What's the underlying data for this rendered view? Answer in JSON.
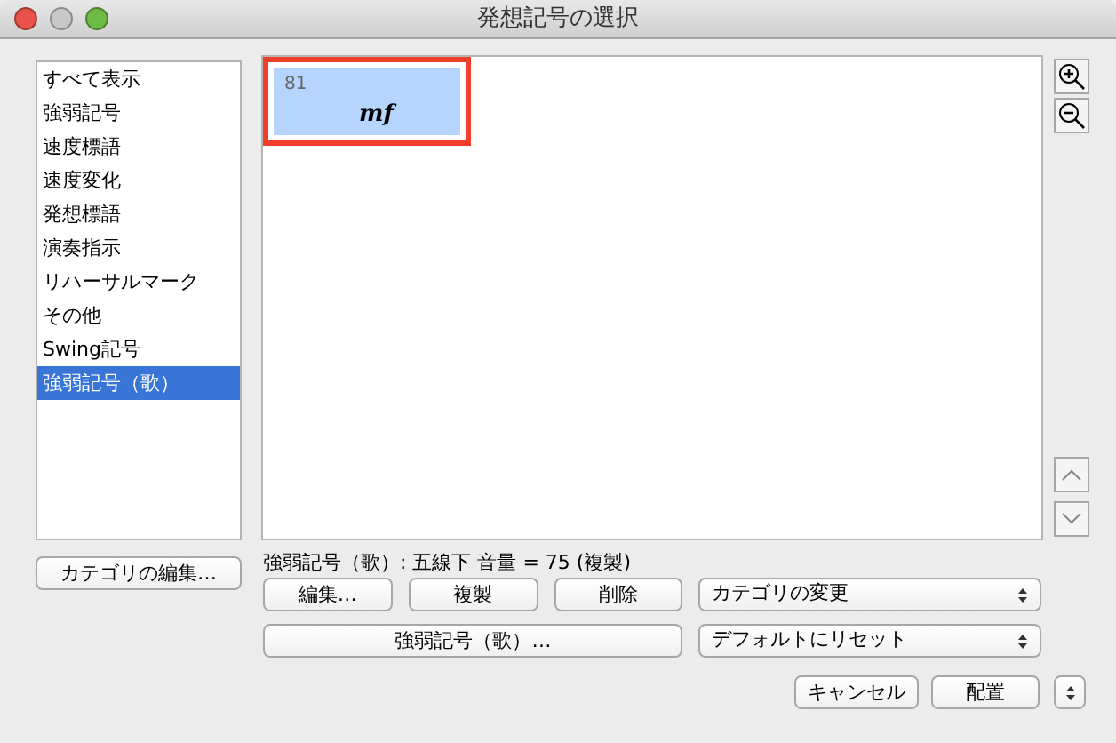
{
  "window": {
    "title": "発想記号の選択"
  },
  "categories": [
    {
      "label": "すべて表示",
      "selected": false
    },
    {
      "label": "強弱記号",
      "selected": false
    },
    {
      "label": "速度標語",
      "selected": false
    },
    {
      "label": "速度変化",
      "selected": false
    },
    {
      "label": "発想標語",
      "selected": false
    },
    {
      "label": "演奏指示",
      "selected": false
    },
    {
      "label": "リハーサルマーク",
      "selected": false
    },
    {
      "label": "その他",
      "selected": false
    },
    {
      "label": "Swing記号",
      "selected": false
    },
    {
      "label": "強弱記号（歌）",
      "selected": true
    }
  ],
  "symbols": [
    {
      "number": "81",
      "glyph": "mf",
      "selected": true
    }
  ],
  "status": "強弱記号（歌）: 五線下 音量 = 75 (複製)",
  "edit_categories_button": "カテゴリの編集…",
  "action_buttons": [
    "編集…",
    "複製",
    "削除"
  ],
  "change_category_select": "カテゴリの変更",
  "category_button": "強弱記号（歌）…",
  "reset_select": "デフォルトにリセット",
  "footer_buttons": [
    "キャンセル",
    "配置"
  ]
}
